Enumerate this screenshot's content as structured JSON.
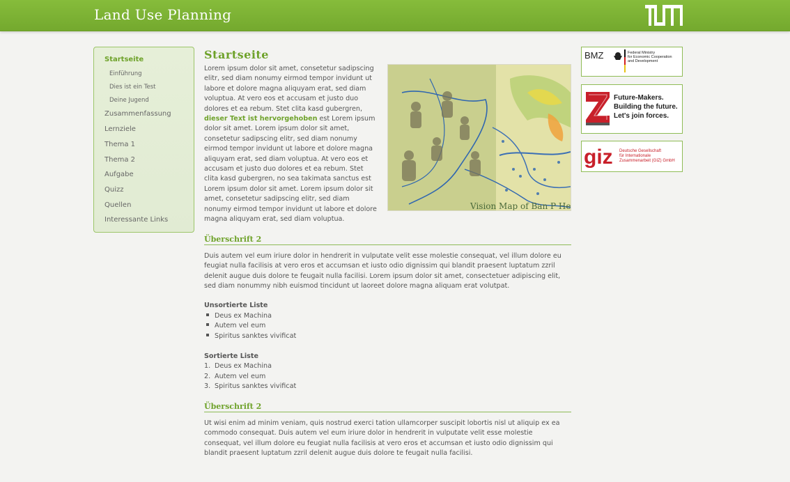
{
  "header": {
    "site_title": "Land Use Planning",
    "logo_label": "TUM"
  },
  "sidebar": {
    "items": [
      {
        "label": "Startseite",
        "level": "top",
        "active": true
      },
      {
        "label": "Einführung",
        "level": "sub"
      },
      {
        "label": "Dies ist ein Test",
        "level": "sub"
      },
      {
        "label": "Deine Jugend",
        "level": "sub"
      },
      {
        "label": "Zusammenfassung",
        "level": "top"
      },
      {
        "label": "Lernziele",
        "level": "top"
      },
      {
        "label": "Thema 1",
        "level": "top"
      },
      {
        "label": "Thema 2",
        "level": "top"
      },
      {
        "label": "Aufgabe",
        "level": "top"
      },
      {
        "label": "Quizz",
        "level": "top"
      },
      {
        "label": "Quellen",
        "level": "top"
      },
      {
        "label": "Interessante Links",
        "level": "top"
      }
    ]
  },
  "main": {
    "title": "Startseite",
    "intro_before": "Lorem ipsum dolor sit amet, consetetur sadipscing elitr, sed diam nonumy eirmod tempor invidunt ut labore et dolore magna aliquyam erat, sed diam voluptua. At vero eos et accusam et justo duo dolores et ea rebum. Stet clita kasd gubergren,",
    "intro_highlight": "dieser Text ist hervorgehoben",
    "intro_after": " est Lorem ipsum dolor sit amet. Lorem ipsum dolor sit amet, consetetur sadipscing elitr, sed diam nonumy eirmod tempor invidunt ut labore et dolore magna aliquyam erat, sed diam voluptua. At vero eos et accusam et justo duo dolores et ea rebum. Stet clita kasd gubergren, no sea takimata sanctus est Lorem ipsum dolor sit amet. Lorem ipsum dolor sit amet, consetetur sadipscing elitr, sed diam nonumy eirmod tempor invidunt ut labore et dolore magna aliquyam erat, sed diam voluptua.",
    "photo_caption_text": "Vision Map of Ban P Hen",
    "section1": {
      "heading": "Überschrift 2",
      "paragraph": "Duis autem vel eum iriure dolor in hendrerit in vulputate velit esse molestie consequat, vel illum dolore eu feugiat nulla facilisis at vero eros et accumsan et iusto odio dignissim qui blandit praesent luptatum zzril delenit augue duis dolore te feugait nulla facilisi. Lorem ipsum dolor sit amet, consectetuer adipiscing elit, sed diam nonummy nibh euismod tincidunt ut laoreet dolore magna aliquam erat volutpat.",
      "unordered_title": "Unsortierte Liste",
      "unordered": [
        "Deus ex Machina",
        "Autem vel eum",
        "Spiritus sanktes vivificat"
      ],
      "ordered_title": "Sortierte Liste",
      "ordered": [
        "Deus ex Machina",
        "Autem vel eum",
        "Spiritus sanktes vivificat"
      ]
    },
    "section2": {
      "heading": "Überschrift 2",
      "paragraph": "Ut wisi enim ad minim veniam, quis nostrud exerci tation ullamcorper suscipit lobortis nisl ut aliquip ex ea commodo consequat. Duis autem vel eum iriure dolor in hendrerit in vulputate velit esse molestie consequat, vel illum dolore eu feugiat nulla facilisis at vero eros et accumsan et iusto odio dignissim qui blandit praesent luptatum zzril delenit augue duis dolore te feugait nulla facilisi."
    }
  },
  "ads": {
    "bmz": {
      "abbr": "BMZ",
      "text1": "Federal Ministry",
      "text2": "for Economic Cooperation",
      "text3": "and Development"
    },
    "future": {
      "line1": "Future-Makers.",
      "line2": "Building the future.",
      "line3": "Let's join forces."
    },
    "giz": {
      "abbr": "giz",
      "text1": "Deutsche Gesellschaft",
      "text2": "für Internationale",
      "text3": "Zusammenarbeit (GIZ) GmbH"
    }
  },
  "colors": {
    "accent": "#6ea22a",
    "header": "#7db334",
    "sidebar_bg": "#e4edd6"
  }
}
